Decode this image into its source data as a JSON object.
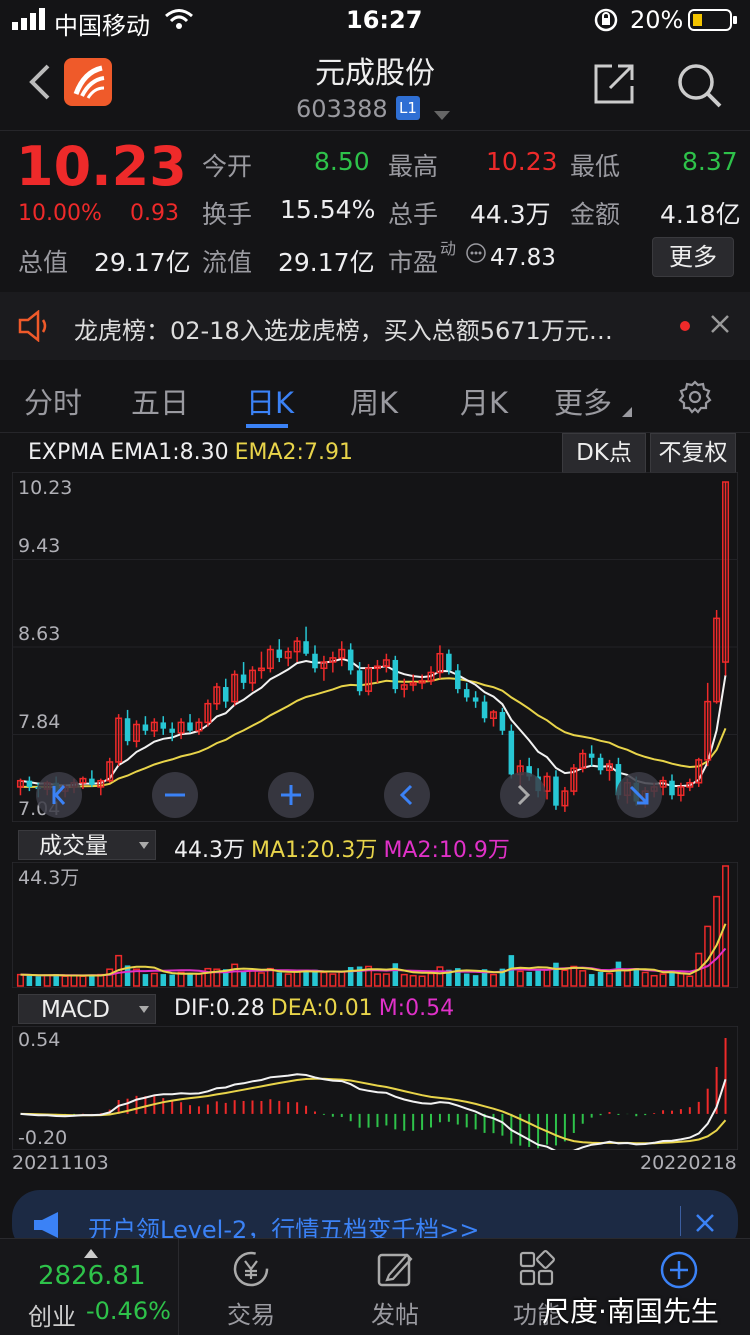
{
  "status_bar": {
    "carrier": "中国移动",
    "time": "16:27",
    "battery": "20%"
  },
  "header": {
    "title": "元成股份",
    "code": "603388",
    "level_badge": "L1"
  },
  "quote": {
    "price": "10.23",
    "change_pct": "10.00%",
    "change": "0.93",
    "open_label": "今开",
    "open": "8.50",
    "high_label": "最高",
    "high": "10.23",
    "low_label": "最低",
    "low": "8.37",
    "turnover_label": "换手",
    "turnover": "15.54%",
    "volume_label": "总手",
    "volume": "44.3万",
    "amount_label": "金额",
    "amount": "4.18亿",
    "total_cap_label": "总值",
    "total_cap": "29.17亿",
    "float_cap_label": "流值",
    "float_cap": "29.17亿",
    "pe_label": "市盈",
    "pe_sup": "动",
    "pe": "47.83",
    "more_button": "更多"
  },
  "notice": {
    "text": "龙虎榜：02-18入选龙虎榜，买入总额5671万元…"
  },
  "tabs": [
    "分时",
    "五日",
    "日K",
    "周K",
    "月K",
    "更多"
  ],
  "active_tab": "日K",
  "kline": {
    "indicator": "EXPMA",
    "ema1": "EMA1:8.30",
    "ema2": "EMA2:7.91",
    "dk_button": "DK点",
    "adjust_button": "不复权",
    "price_labels": [
      "10.23",
      "9.43",
      "8.63",
      "7.84",
      "7.04"
    ]
  },
  "volume_panel": {
    "selector": "成交量",
    "current": "44.3万",
    "ma1": "MA1:20.3万",
    "ma2": "MA2:10.9万",
    "max_label": "44.3万"
  },
  "macd_panel": {
    "selector": "MACD",
    "dif": "DIF:0.28",
    "dea": "DEA:0.01",
    "m": "M:0.54",
    "top_label": "0.54",
    "bottom_label": "-0.20"
  },
  "date_range": {
    "start": "20211103",
    "end": "20220218"
  },
  "ad_banner": {
    "text": "开户领Level-2，行情五档变千档>>"
  },
  "bottom_nav": {
    "index_value": "2826.81",
    "index_name": "创业",
    "index_change": "-0.46%",
    "items": [
      "交易",
      "发帖",
      "功能",
      ""
    ]
  },
  "watermark": "尺度·南国先生",
  "colors": {
    "up": "#ee2a2a",
    "down": "#27c7d4",
    "ema1": "#f2f2f2",
    "ema2": "#e8d44a",
    "active": "#3b82f6"
  },
  "chart_data": {
    "type": "candlestick",
    "y_range": [
      7.04,
      10.23
    ],
    "candles": [
      [
        7.3,
        7.38,
        7.22,
        7.36
      ],
      [
        7.36,
        7.4,
        7.26,
        7.3
      ],
      [
        7.3,
        7.34,
        7.2,
        7.28
      ],
      [
        7.28,
        7.36,
        7.22,
        7.34
      ],
      [
        7.34,
        7.4,
        7.24,
        7.26
      ],
      [
        7.26,
        7.32,
        7.2,
        7.3
      ],
      [
        7.3,
        7.38,
        7.24,
        7.34
      ],
      [
        7.34,
        7.4,
        7.28,
        7.38
      ],
      [
        7.38,
        7.46,
        7.3,
        7.32
      ],
      [
        7.3,
        7.38,
        7.22,
        7.36
      ],
      [
        7.36,
        7.58,
        7.34,
        7.54
      ],
      [
        7.54,
        8.0,
        7.5,
        7.96
      ],
      [
        7.96,
        8.04,
        7.7,
        7.74
      ],
      [
        7.74,
        7.94,
        7.68,
        7.9
      ],
      [
        7.9,
        7.98,
        7.8,
        7.84
      ],
      [
        7.84,
        7.96,
        7.78,
        7.92
      ],
      [
        7.92,
        7.98,
        7.8,
        7.86
      ],
      [
        7.86,
        7.92,
        7.74,
        7.82
      ],
      [
        7.82,
        7.96,
        7.76,
        7.92
      ],
      [
        7.92,
        8.0,
        7.82,
        7.84
      ],
      [
        7.84,
        7.96,
        7.8,
        7.92
      ],
      [
        7.92,
        8.14,
        7.88,
        8.1
      ],
      [
        8.1,
        8.3,
        8.04,
        8.26
      ],
      [
        8.26,
        8.34,
        8.06,
        8.12
      ],
      [
        8.12,
        8.42,
        8.08,
        8.38
      ],
      [
        8.38,
        8.5,
        8.24,
        8.3
      ],
      [
        8.3,
        8.46,
        8.22,
        8.42
      ],
      [
        8.42,
        8.6,
        8.34,
        8.44
      ],
      [
        8.44,
        8.66,
        8.4,
        8.62
      ],
      [
        8.62,
        8.72,
        8.5,
        8.54
      ],
      [
        8.54,
        8.64,
        8.46,
        8.6
      ],
      [
        8.6,
        8.74,
        8.5,
        8.7
      ],
      [
        8.7,
        8.84,
        8.56,
        8.58
      ],
      [
        8.58,
        8.66,
        8.4,
        8.44
      ],
      [
        8.44,
        8.56,
        8.32,
        8.5
      ],
      [
        8.5,
        8.6,
        8.4,
        8.54
      ],
      [
        8.54,
        8.7,
        8.46,
        8.62
      ],
      [
        8.62,
        8.68,
        8.38,
        8.42
      ],
      [
        8.42,
        8.5,
        8.18,
        8.22
      ],
      [
        8.22,
        8.48,
        8.18,
        8.44
      ],
      [
        8.44,
        8.52,
        8.3,
        8.46
      ],
      [
        8.46,
        8.58,
        8.4,
        8.52
      ],
      [
        8.52,
        8.56,
        8.2,
        8.24
      ],
      [
        8.24,
        8.34,
        8.16,
        8.28
      ],
      [
        8.28,
        8.38,
        8.22,
        8.3
      ],
      [
        8.3,
        8.38,
        8.24,
        8.32
      ],
      [
        8.32,
        8.46,
        8.28,
        8.4
      ],
      [
        8.4,
        8.66,
        8.34,
        8.58
      ],
      [
        8.58,
        8.62,
        8.38,
        8.42
      ],
      [
        8.42,
        8.48,
        8.2,
        8.24
      ],
      [
        8.24,
        8.3,
        8.12,
        8.16
      ],
      [
        8.16,
        8.22,
        8.06,
        8.12
      ],
      [
        8.12,
        8.18,
        7.92,
        7.96
      ],
      [
        7.96,
        8.04,
        7.88,
        8.02
      ],
      [
        8.02,
        8.06,
        7.8,
        7.84
      ],
      [
        7.84,
        7.9,
        7.38,
        7.42
      ],
      [
        7.42,
        7.56,
        7.3,
        7.5
      ],
      [
        7.5,
        7.58,
        7.36,
        7.4
      ],
      [
        7.4,
        7.48,
        7.2,
        7.26
      ],
      [
        7.26,
        7.44,
        7.18,
        7.4
      ],
      [
        7.4,
        7.46,
        7.08,
        7.12
      ],
      [
        7.12,
        7.3,
        7.06,
        7.26
      ],
      [
        7.26,
        7.52,
        7.22,
        7.48
      ],
      [
        7.48,
        7.66,
        7.44,
        7.62
      ],
      [
        7.62,
        7.7,
        7.5,
        7.58
      ],
      [
        7.58,
        7.62,
        7.42,
        7.46
      ],
      [
        7.46,
        7.56,
        7.36,
        7.52
      ],
      [
        7.52,
        7.58,
        7.18,
        7.22
      ],
      [
        7.22,
        7.38,
        7.14,
        7.34
      ],
      [
        7.34,
        7.4,
        7.12,
        7.16
      ],
      [
        7.16,
        7.3,
        7.1,
        7.26
      ],
      [
        7.26,
        7.34,
        7.2,
        7.3
      ],
      [
        7.3,
        7.4,
        7.22,
        7.36
      ],
      [
        7.36,
        7.42,
        7.18,
        7.22
      ],
      [
        7.22,
        7.34,
        7.16,
        7.3
      ],
      [
        7.3,
        7.38,
        7.26,
        7.34
      ],
      [
        7.34,
        7.58,
        7.3,
        7.56
      ],
      [
        7.56,
        8.3,
        7.5,
        8.12
      ],
      [
        8.12,
        9.0,
        8.1,
        8.92
      ],
      [
        8.5,
        10.23,
        8.37,
        10.23
      ]
    ],
    "volume_max": 44.3,
    "macd_range": [
      -0.2,
      0.54
    ]
  }
}
